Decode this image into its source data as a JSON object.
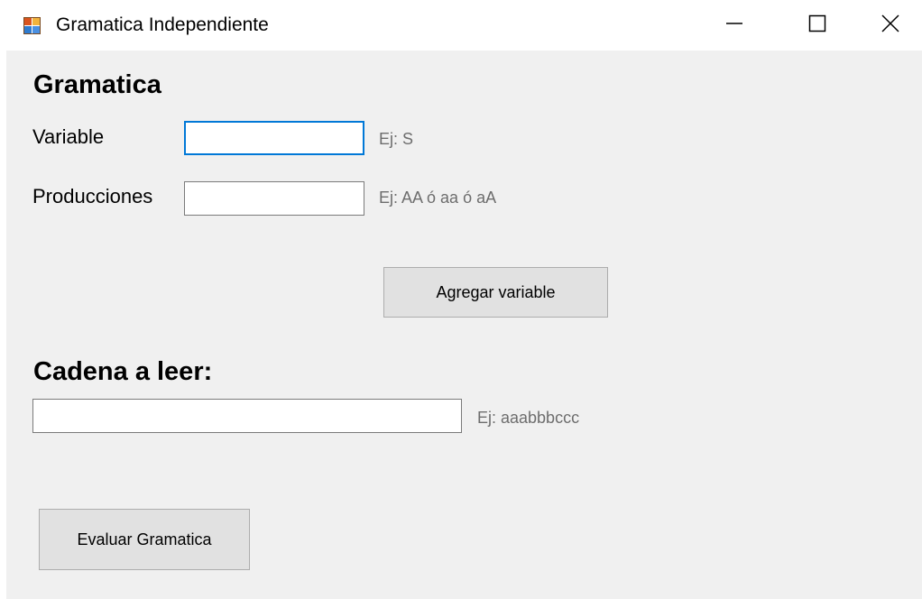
{
  "window": {
    "title": "Gramatica Independiente",
    "icon": "windows-form-icon",
    "controls": {
      "minimize": "minimize-icon",
      "maximize": "maximize-icon",
      "close": "close-icon"
    }
  },
  "form": {
    "grammar_heading": "Gramatica",
    "variable": {
      "label": "Variable",
      "value": "",
      "hint": "Ej: S"
    },
    "producciones": {
      "label": "Producciones",
      "value": "",
      "hint": "Ej: AA ó aa ó aA"
    },
    "add_variable_button": "Agregar variable",
    "cadena_heading": "Cadena a leer:",
    "cadena": {
      "value": "",
      "hint": "Ej: aaabbbccc"
    },
    "evaluate_button": "Evaluar Gramatica"
  },
  "colors": {
    "client_background": "#f0f0f0",
    "focus_border": "#0078d7",
    "button_background": "#e1e1e1",
    "hint_text": "#6d6d6d"
  }
}
